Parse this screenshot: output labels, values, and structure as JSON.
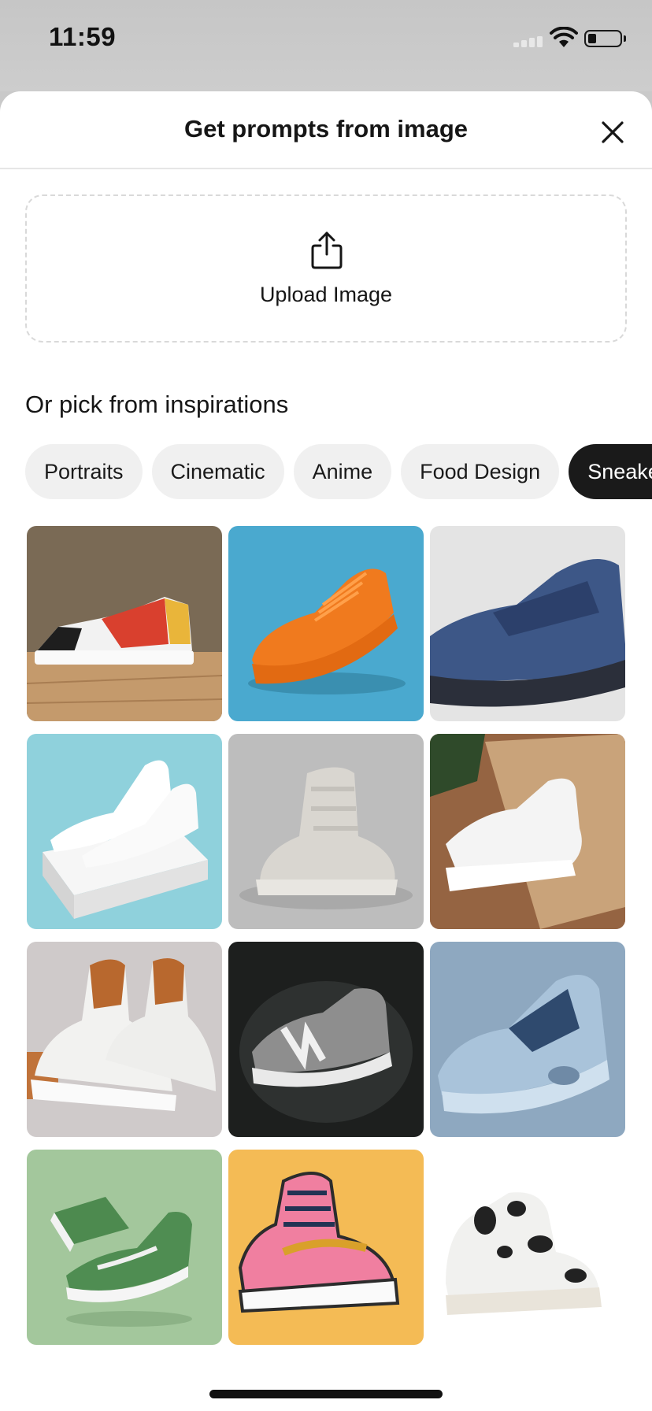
{
  "status_bar": {
    "time": "11:59"
  },
  "sheet": {
    "title": "Get prompts from image",
    "upload_label": "Upload Image",
    "section_title": "Or pick from inspirations"
  },
  "chips": [
    {
      "label": "Portraits",
      "active": false
    },
    {
      "label": "Cinematic",
      "active": false
    },
    {
      "label": "Anime",
      "active": false
    },
    {
      "label": "Food Design",
      "active": false
    },
    {
      "label": "Sneakers",
      "active": true
    }
  ],
  "colors": {
    "accent_dark": "#1a1a1a",
    "chip_bg": "#f0f0f0",
    "sheet_bg": "#ffffff"
  },
  "gallery": [
    {
      "name": "colorful-canvas-sneaker-on-wood"
    },
    {
      "name": "orange-knit-running-sneaker"
    },
    {
      "name": "navy-strap-sneaker"
    },
    {
      "name": "white-sneakers-on-box"
    },
    {
      "name": "grey-high-top-sneaker"
    },
    {
      "name": "white-sneaker-in-cardboard-box"
    },
    {
      "name": "white-tan-leather-sneakers"
    },
    {
      "name": "grey-n-sneaker-dark-background"
    },
    {
      "name": "light-blue-futuristic-sneaker"
    },
    {
      "name": "green-skate-shoes-floating"
    },
    {
      "name": "pink-retro-high-top-illustration"
    },
    {
      "name": "cow-print-high-top-sneaker"
    }
  ]
}
